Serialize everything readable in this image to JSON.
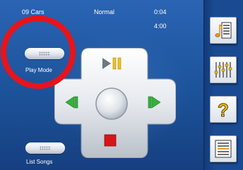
{
  "status": {
    "track_name": "09 Cars",
    "mode": "Normal",
    "elapsed": "0:04",
    "total": "4:00"
  },
  "controls": {
    "play_mode_label": "Play Mode",
    "list_songs_label": "List Songs"
  },
  "icons": {
    "play_pause": "play-pause-icon",
    "previous": "previous-track-icon",
    "next": "next-track-icon",
    "stop": "stop-icon",
    "playlist": "playlist-music-icon",
    "equalizer": "equalizer-icon",
    "help": "help-icon",
    "menu": "menu-list-icon"
  },
  "colors": {
    "background": "#1c5299",
    "accent_yellow": "#f2c21a",
    "accent_green": "#35b23a",
    "stop_red": "#d8141a",
    "highlight_ring": "#e8141a"
  }
}
